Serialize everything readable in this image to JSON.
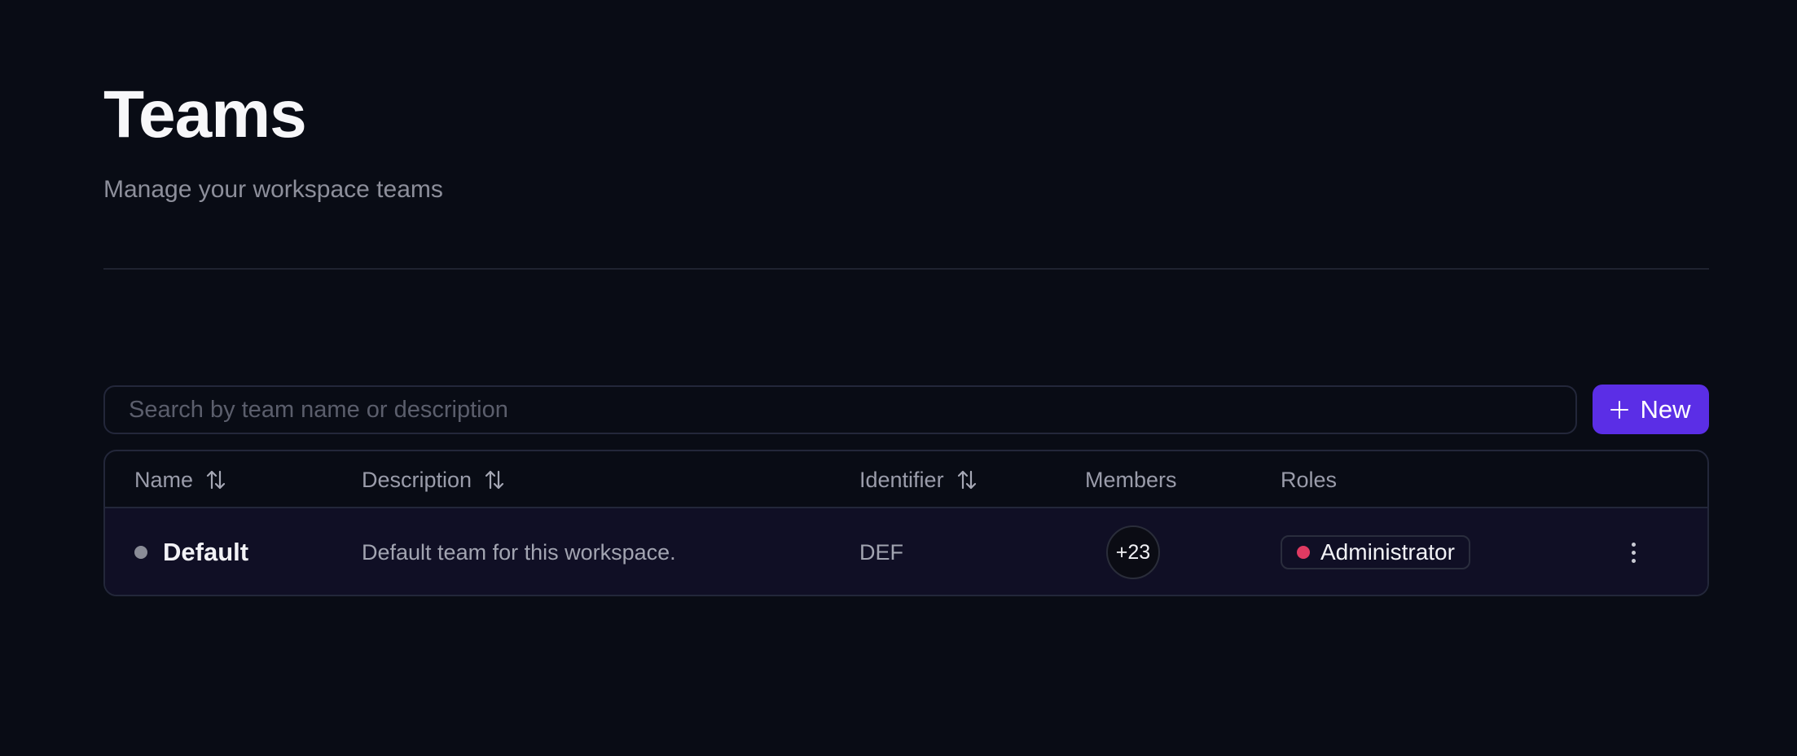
{
  "header": {
    "title": "Teams",
    "subtitle": "Manage your workspace teams"
  },
  "search": {
    "placeholder": "Search by team name or description",
    "value": ""
  },
  "new_button": {
    "label": "New",
    "icon": "plus-icon"
  },
  "table": {
    "columns": [
      {
        "label": "Name",
        "sortable": true
      },
      {
        "label": "Description",
        "sortable": true
      },
      {
        "label": "Identifier",
        "sortable": true
      },
      {
        "label": "Members",
        "sortable": false
      },
      {
        "label": "Roles",
        "sortable": false
      }
    ],
    "rows": [
      {
        "name": "Default",
        "description": "Default team for this workspace.",
        "identifier": "DEF",
        "members": "+23",
        "role": "Administrator"
      }
    ]
  },
  "colors": {
    "background": "#090c15",
    "accent": "#5b2ee6",
    "row_highlight": "#100f25",
    "role_dot": "#e03a62"
  }
}
